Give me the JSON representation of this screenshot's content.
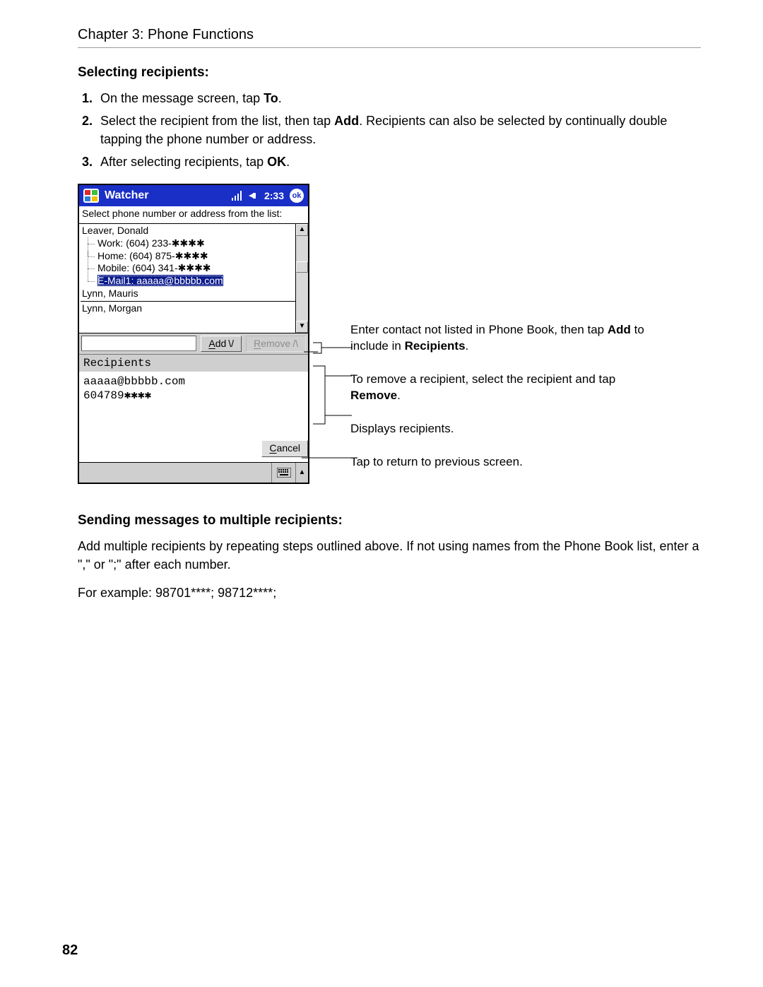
{
  "header": {
    "chapter": "Chapter 3: Phone Functions"
  },
  "section1": {
    "title": "Selecting recipients:",
    "steps": {
      "s1a": "On the message screen, tap ",
      "s1b": "To",
      "s1c": ".",
      "s2a": "Select the recipient from the list, then tap ",
      "s2b": "Add",
      "s2c": ". Recipients can also be selected by continually double tapping the phone number or address.",
      "s3a": "After selecting recipients, tap ",
      "s3b": "OK",
      "s3c": "."
    }
  },
  "device": {
    "titlebar": {
      "app": "Watcher",
      "time": "2:33",
      "ok": "ok"
    },
    "instruction": "Select phone number or address from the list:",
    "tree": {
      "c1": "Leaver, Donald",
      "c1_work": "Work: (604) 233-✱✱✱✱",
      "c1_home": "Home: (604) 875-✱✱✱✱",
      "c1_mobile": "Mobile: (604) 341-✱✱✱✱",
      "c1_email": "E-Mail1: aaaaa@bbbbb.com",
      "c2": "Lynn, Mauris",
      "c3": "Lynn, Morgan"
    },
    "buttons": {
      "add_u": "A",
      "add_rest": "dd",
      "add_glyph": "\\/",
      "remove_u": "R",
      "remove_rest": "emove",
      "remove_glyph": "/\\",
      "cancel_u": "C",
      "cancel_rest": "ancel"
    },
    "recipients_label": "Recipients",
    "recipients": {
      "r1": "aaaaa@bbbbb.com",
      "r2": "604789✱✱✱✱"
    }
  },
  "callouts": {
    "c1a": "Enter contact not listed in Phone Book, then tap ",
    "c1b": "Add",
    "c1c": " to include in ",
    "c1d": "Recipients",
    "c1e": ".",
    "c2a": "To remove a recipient, select the recipient and tap ",
    "c2b": "Remove",
    "c2c": ".",
    "c3": "Displays recipients.",
    "c4": "Tap to return to previous screen."
  },
  "section2": {
    "title": "Sending messages to multiple recipients:",
    "p1": "Add multiple recipients by repeating steps outlined above. If not using names from the Phone Book list, enter a \",\" or \";\" after each number.",
    "p2": "For example: 98701****; 98712****;"
  },
  "page_number": "82"
}
